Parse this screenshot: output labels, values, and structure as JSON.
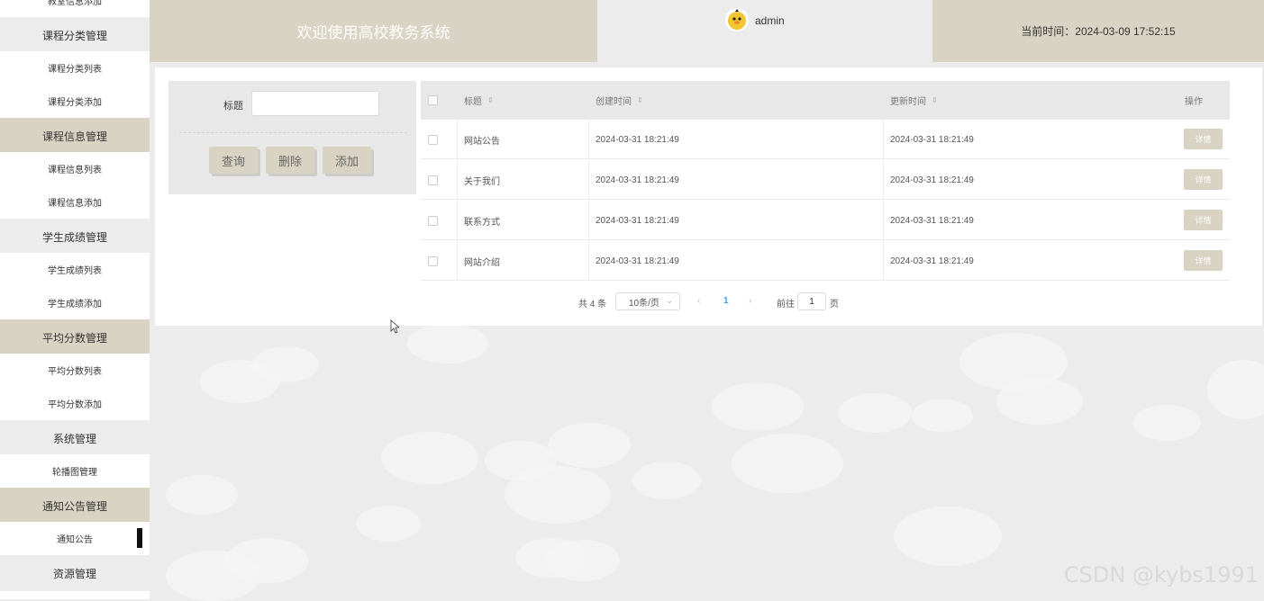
{
  "colors": {
    "accent": "#d8d3c3",
    "bg": "#ececec",
    "white": "#ffffff"
  },
  "header": {
    "title": "欢迎使用高校教务系统",
    "username": "admin",
    "time_label": "当前时间：2024-03-09 17:52:15"
  },
  "sidebar": {
    "rows": [
      {
        "label": "教室信息添加",
        "kind": "item"
      },
      {
        "label": "课程分类管理",
        "kind": "group"
      },
      {
        "label": "课程分类列表",
        "kind": "item"
      },
      {
        "label": "课程分类添加",
        "kind": "item"
      },
      {
        "label": "课程信息管理",
        "kind": "group"
      },
      {
        "label": "课程信息列表",
        "kind": "item"
      },
      {
        "label": "课程信息添加",
        "kind": "item"
      },
      {
        "label": "学生成绩管理",
        "kind": "group"
      },
      {
        "label": "学生成绩列表",
        "kind": "item"
      },
      {
        "label": "学生成绩添加",
        "kind": "item"
      },
      {
        "label": "平均分数管理",
        "kind": "group"
      },
      {
        "label": "平均分数列表",
        "kind": "item"
      },
      {
        "label": "平均分数添加",
        "kind": "item"
      },
      {
        "label": "系统管理",
        "kind": "group"
      },
      {
        "label": "轮播图管理",
        "kind": "item"
      },
      {
        "label": "通知公告管理",
        "kind": "group"
      },
      {
        "label": "通知公告",
        "kind": "item",
        "active": true
      },
      {
        "label": "资源管理",
        "kind": "group"
      }
    ]
  },
  "search": {
    "label": "标题",
    "value": "",
    "buttons": {
      "query": "查询",
      "delete": "删除",
      "add": "添加"
    }
  },
  "table": {
    "columns": {
      "title": "标题",
      "created": "创建时间",
      "updated": "更新时间",
      "action": "操作"
    },
    "rows": [
      {
        "title": "网站公告",
        "created": "2024-03-31 18:21:49",
        "updated": "2024-03-31 18:21:49",
        "action": "详情"
      },
      {
        "title": "关于我们",
        "created": "2024-03-31 18:21:49",
        "updated": "2024-03-31 18:21:49",
        "action": "详情"
      },
      {
        "title": "联系方式",
        "created": "2024-03-31 18:21:49",
        "updated": "2024-03-31 18:21:49",
        "action": "详情"
      },
      {
        "title": "网站介绍",
        "created": "2024-03-31 18:21:49",
        "updated": "2024-03-31 18:21:49",
        "action": "详情"
      }
    ]
  },
  "pagination": {
    "total": "共 4 条",
    "page_size": "10条/页",
    "prev": "‹",
    "current": "1",
    "next": "›",
    "goto_prefix": "前往",
    "goto_value": "1",
    "goto_suffix": "页"
  },
  "watermark": "CSDN @kybs1991"
}
